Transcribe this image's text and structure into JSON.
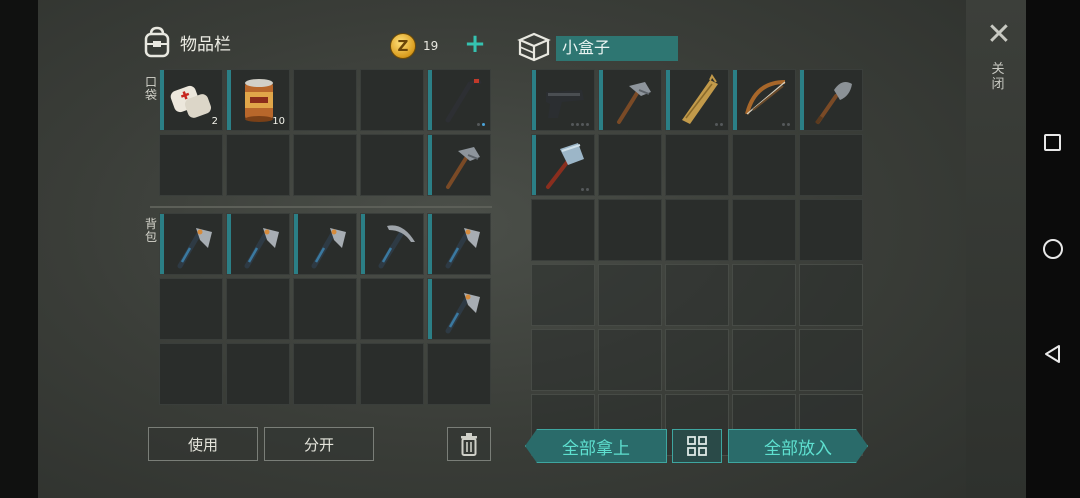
{
  "inventory": {
    "title": "物品栏",
    "coins": "19",
    "pocket_label": "口袋",
    "backpack_label": "背包",
    "pocket": [
      {
        "icon": "bandage-icon",
        "count": "2"
      },
      {
        "icon": "food-can-icon",
        "count": "10"
      },
      {
        "icon": ""
      },
      {
        "icon": ""
      },
      {
        "icon": "crowbar-icon",
        "dots": [
          false,
          true
        ]
      },
      {
        "icon": ""
      },
      {
        "icon": ""
      },
      {
        "icon": ""
      },
      {
        "icon": ""
      },
      {
        "icon": "hammer-icon"
      }
    ],
    "backpack": [
      {
        "icon": "axe-icon"
      },
      {
        "icon": "axe-icon"
      },
      {
        "icon": "axe-icon"
      },
      {
        "icon": "pickaxe-icon"
      },
      {
        "icon": "axe-icon"
      },
      {
        "icon": ""
      },
      {
        "icon": ""
      },
      {
        "icon": ""
      },
      {
        "icon": ""
      },
      {
        "icon": "axe-icon"
      },
      {
        "icon": ""
      },
      {
        "icon": ""
      },
      {
        "icon": ""
      },
      {
        "icon": ""
      },
      {
        "icon": ""
      }
    ]
  },
  "container": {
    "name": "小盒子",
    "slots": [
      {
        "icon": "pistol-icon",
        "dots": [
          false,
          false,
          false,
          false
        ]
      },
      {
        "icon": "hammer-icon"
      },
      {
        "icon": "wood-plank-icon",
        "dots": [
          false,
          false
        ]
      },
      {
        "icon": "bow-icon",
        "dots": [
          false,
          false
        ]
      },
      {
        "icon": "shovel-icon"
      },
      {
        "icon": "sledgehammer-icon",
        "dots": [
          false,
          false
        ]
      },
      {
        "icon": ""
      },
      {
        "icon": ""
      },
      {
        "icon": ""
      },
      {
        "icon": ""
      },
      {
        "icon": ""
      },
      {
        "icon": ""
      },
      {
        "icon": ""
      },
      {
        "icon": ""
      },
      {
        "icon": ""
      }
    ],
    "ghost_rows": 3
  },
  "buttons": {
    "use": "使用",
    "split": "分开",
    "take_all": "全部拿上",
    "put_all": "全部放入"
  },
  "close_label": "关闭",
  "colors": {
    "accent": "#35c2b0",
    "slot_bar": "#2b7f86",
    "name_box": "#2e7672"
  }
}
